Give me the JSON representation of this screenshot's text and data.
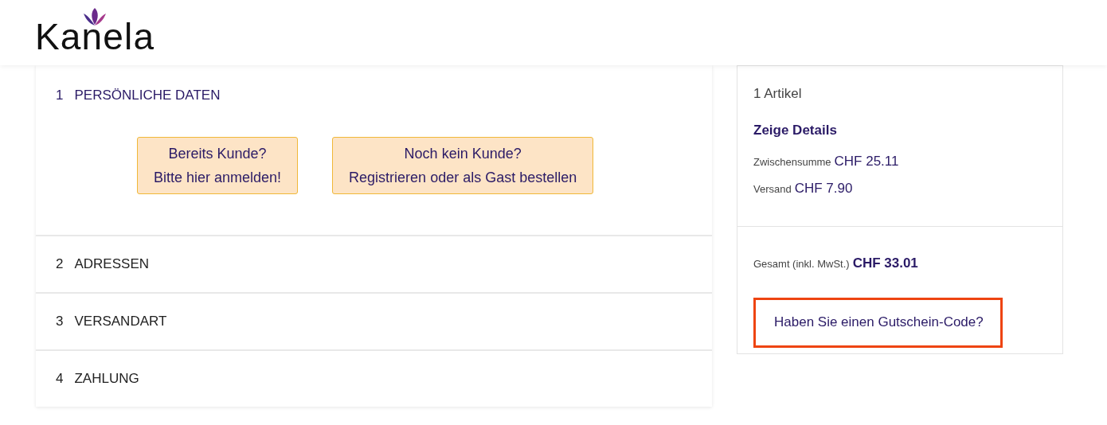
{
  "header": {
    "logo": "Kanela"
  },
  "steps": [
    {
      "number": "1",
      "title": "PERSÖNLICHE DATEN",
      "active": true,
      "buttons": [
        {
          "line1": "Bereits Kunde?",
          "line2": "Bitte hier anmelden!"
        },
        {
          "line1": "Noch kein Kunde?",
          "line2": "Registrieren oder als Gast bestellen"
        }
      ]
    },
    {
      "number": "2",
      "title": "ADRESSEN",
      "active": false
    },
    {
      "number": "3",
      "title": "VERSANDART",
      "active": false
    },
    {
      "number": "4",
      "title": "ZAHLUNG",
      "active": false
    }
  ],
  "summary": {
    "items_count": "1 Artikel",
    "details_link": "Zeige Details",
    "lines": [
      {
        "label": "Zwischensumme",
        "value": "CHF 25.11"
      },
      {
        "label": "Versand",
        "value": "CHF 7.90"
      }
    ],
    "total": {
      "label": "Gesamt (inkl. MwSt.)",
      "value": "CHF 33.01"
    },
    "coupon_link": {
      "text": "Haben Sie einen Gutschein-Code?",
      "highlighted": true
    }
  }
}
